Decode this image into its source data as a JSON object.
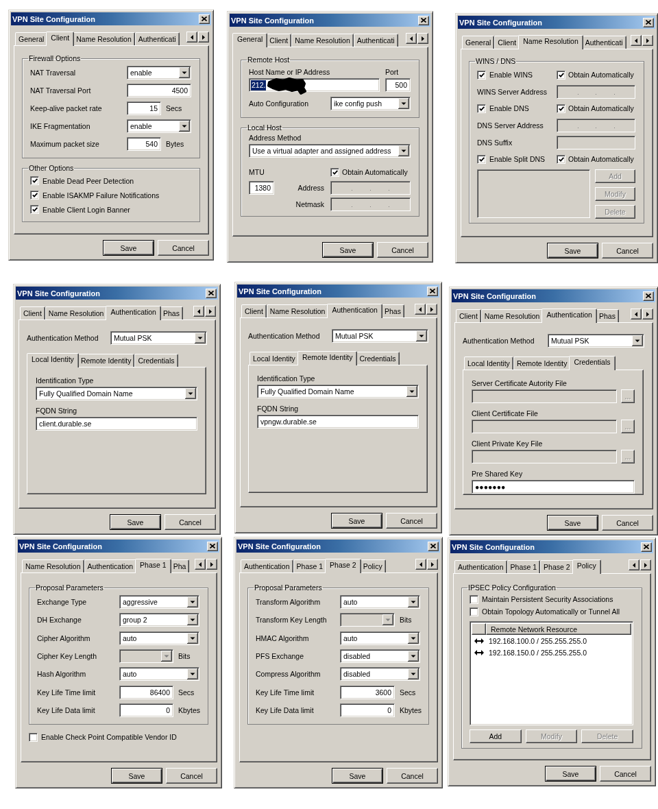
{
  "windows": [
    {
      "title": "VPN Site Configuration",
      "tabs": [
        {
          "label": "General",
          "selected": false
        },
        {
          "label": "Client",
          "selected": true
        },
        {
          "label": "Name Resolution",
          "selected": false
        },
        {
          "label": "Authenticati",
          "selected": false
        }
      ],
      "content": [
        {
          "kind": "group",
          "title": "Firewall Options",
          "items": [
            {
              "kind": "field",
              "label": "NAT Traversal",
              "control": {
                "kind": "select",
                "value": "enable",
                "disabled": false
              }
            },
            {
              "kind": "field",
              "label": "NAT Traversal Port",
              "control": {
                "kind": "text",
                "value": "4500",
                "disabled": false
              }
            },
            {
              "kind": "field",
              "label": "Keep-alive packet rate",
              "unit": "Secs",
              "control": {
                "kind": "text",
                "value": "15",
                "disabled": false
              }
            },
            {
              "kind": "field",
              "label": "IKE Fragmentation",
              "control": {
                "kind": "select",
                "value": "enable",
                "disabled": false
              }
            },
            {
              "kind": "field",
              "label": "Maximum packet size",
              "unit": "Bytes",
              "control": {
                "kind": "text",
                "value": "540",
                "disabled": false
              }
            }
          ]
        },
        {
          "kind": "group",
          "title": "Other Options",
          "items": [
            {
              "kind": "checkbox",
              "label": "Enable Dead Peer Detection",
              "checked": true
            },
            {
              "kind": "checkbox",
              "label": "Enable ISAKMP Failure Notifications",
              "checked": true
            },
            {
              "kind": "checkbox",
              "label": "Enable Client Login Banner",
              "checked": true
            }
          ]
        }
      ],
      "buttons": [
        {
          "label": "Save",
          "default": true
        },
        {
          "label": "Cancel",
          "default": false
        }
      ]
    },
    {
      "title": "VPN Site Configuration",
      "tabs": [
        {
          "label": "General",
          "selected": true
        },
        {
          "label": "Client",
          "selected": false
        },
        {
          "label": "Name Resolution",
          "selected": false
        },
        {
          "label": "Authenticati",
          "selected": false
        }
      ],
      "content": [
        {
          "kind": "group",
          "title": "Remote Host",
          "items": [
            {
              "kind": "host_port",
              "label": "Host Name or IP Address",
              "value": "212.",
              "selected": true,
              "redacted": true,
              "port_label": "Port",
              "port": "500"
            },
            {
              "kind": "field",
              "label": "Auto Configuration",
              "control": {
                "kind": "select",
                "value": "ike config push",
                "disabled": false
              }
            }
          ]
        },
        {
          "kind": "group",
          "title": "Local Host",
          "items": [
            {
              "kind": "stacked",
              "label": "Address Method",
              "control": {
                "kind": "select",
                "value": "Use a virtual adapter and assigned address",
                "disabled": false
              }
            },
            {
              "kind": "mtu",
              "label": "MTU",
              "value": "1380",
              "checkbox": {
                "label": "Obtain Automatically",
                "checked": true
              },
              "fields": [
                {
                  "label": "Address",
                  "control": {
                    "kind": "ip",
                    "disabled": true
                  }
                },
                {
                  "label": "Netmask",
                  "control": {
                    "kind": "ip",
                    "disabled": true
                  }
                }
              ]
            }
          ]
        }
      ],
      "buttons": [
        {
          "label": "Save",
          "default": true
        },
        {
          "label": "Cancel",
          "default": false
        }
      ]
    },
    {
      "title": "VPN Site Configuration",
      "tabs": [
        {
          "label": "General",
          "selected": false
        },
        {
          "label": "Client",
          "selected": false
        },
        {
          "label": "Name Resolution",
          "selected": true
        },
        {
          "label": "Authenticati",
          "selected": false
        }
      ],
      "content": [
        {
          "kind": "group",
          "title": "WINS / DNS",
          "items": [
            {
              "kind": "checkbox_pair",
              "items": [
                {
                  "label": "Enable WINS",
                  "checked": true
                },
                {
                  "label": "Obtain Automatically",
                  "checked": true
                }
              ]
            },
            {
              "kind": "field",
              "label": "WINS Server Address",
              "control": {
                "kind": "ip",
                "disabled": true
              }
            },
            {
              "kind": "checkbox_pair",
              "items": [
                {
                  "label": "Enable DNS",
                  "checked": true
                },
                {
                  "label": "Obtain Automatically",
                  "checked": true
                }
              ]
            },
            {
              "kind": "field",
              "label": "DNS Server Address",
              "control": {
                "kind": "ip",
                "disabled": true
              }
            },
            {
              "kind": "field",
              "label": "DNS Suffix",
              "control": {
                "kind": "text",
                "disabled": true
              }
            },
            {
              "kind": "checkbox_pair",
              "items": [
                {
                  "label": "Enable Split DNS",
                  "checked": true
                },
                {
                  "label": "Obtain Automatically",
                  "checked": true
                }
              ]
            },
            {
              "kind": "list_buttons",
              "disabled": true,
              "buttons": [
                {
                  "label": "Add",
                  "disabled": true
                },
                {
                  "label": "Modify",
                  "disabled": true
                },
                {
                  "label": "Delete",
                  "disabled": true
                }
              ]
            }
          ]
        }
      ],
      "buttons": [
        {
          "label": "Save",
          "default": true
        },
        {
          "label": "Cancel",
          "default": false
        }
      ]
    },
    {
      "title": "VPN Site Configuration",
      "tabs": [
        {
          "label": "Client",
          "selected": false
        },
        {
          "label": "Name Resolution",
          "selected": false
        },
        {
          "label": "Authentication",
          "selected": true
        },
        {
          "label": "Phas",
          "selected": false
        }
      ],
      "content": [
        {
          "kind": "field",
          "label": "Authentication Method",
          "control": {
            "kind": "select",
            "value": "Mutual PSK",
            "disabled": false
          }
        },
        {
          "kind": "subtabs",
          "tabs": [
            {
              "label": "Local Identity",
              "selected": true
            },
            {
              "label": "Remote Identity",
              "selected": false
            },
            {
              "label": "Credentials",
              "selected": false
            }
          ],
          "items": [
            {
              "kind": "stacked",
              "label": "Identification Type",
              "control": {
                "kind": "select",
                "value": "Fully Qualified Domain Name",
                "disabled": false
              }
            },
            {
              "kind": "stacked",
              "label": "FQDN String",
              "control": {
                "kind": "text",
                "value": "client.durable.se",
                "disabled": false
              }
            }
          ]
        }
      ],
      "buttons": [
        {
          "label": "Save",
          "default": true
        },
        {
          "label": "Cancel",
          "default": false
        }
      ]
    },
    {
      "title": "VPN Site Configuration",
      "tabs": [
        {
          "label": "Client",
          "selected": false
        },
        {
          "label": "Name Resolution",
          "selected": false
        },
        {
          "label": "Authentication",
          "selected": true
        },
        {
          "label": "Phas",
          "selected": false
        }
      ],
      "content": [
        {
          "kind": "field",
          "label": "Authentication Method",
          "control": {
            "kind": "select",
            "value": "Mutual PSK",
            "disabled": false
          }
        },
        {
          "kind": "subtabs",
          "tabs": [
            {
              "label": "Local Identity",
              "selected": false
            },
            {
              "label": "Remote Identity",
              "selected": true
            },
            {
              "label": "Credentials",
              "selected": false
            }
          ],
          "items": [
            {
              "kind": "stacked",
              "label": "Identification Type",
              "control": {
                "kind": "select",
                "value": "Fully Qualified Domain Name",
                "disabled": false
              }
            },
            {
              "kind": "stacked",
              "label": "FQDN String",
              "control": {
                "kind": "text",
                "value": "vpngw.durable.se",
                "disabled": false
              }
            }
          ]
        }
      ],
      "buttons": [
        {
          "label": "Save",
          "default": true
        },
        {
          "label": "Cancel",
          "default": false
        }
      ]
    },
    {
      "title": "VPN Site Configuration",
      "tabs": [
        {
          "label": "Client",
          "selected": false
        },
        {
          "label": "Name Resolution",
          "selected": false
        },
        {
          "label": "Authentication",
          "selected": true
        },
        {
          "label": "Phas",
          "selected": false
        }
      ],
      "content": [
        {
          "kind": "field",
          "label": "Authentication Method",
          "control": {
            "kind": "select",
            "value": "Mutual PSK",
            "disabled": false
          }
        },
        {
          "kind": "subtabs",
          "tabs": [
            {
              "label": "Local Identity",
              "selected": false
            },
            {
              "label": "Remote Identity",
              "selected": false
            },
            {
              "label": "Credentials",
              "selected": true
            }
          ],
          "items": [
            {
              "kind": "stacked",
              "label": "Server Certificate Autority File",
              "control": {
                "kind": "text",
                "disabled": true
              },
              "browse": {
                "label": "...",
                "disabled": true
              }
            },
            {
              "kind": "stacked",
              "label": "Client Certificate File",
              "control": {
                "kind": "text",
                "disabled": true
              },
              "browse": {
                "label": "...",
                "disabled": true
              }
            },
            {
              "kind": "stacked",
              "label": "Client Private Key File",
              "control": {
                "kind": "text",
                "disabled": true
              },
              "browse": {
                "label": "...",
                "disabled": true
              }
            },
            {
              "kind": "stacked",
              "label": "Pre Shared Key",
              "control": {
                "kind": "text",
                "value": "●●●●●●●",
                "disabled": false
              }
            }
          ]
        }
      ],
      "buttons": [
        {
          "label": "Save",
          "default": true
        },
        {
          "label": "Cancel",
          "default": false
        }
      ]
    },
    {
      "title": "VPN Site Configuration",
      "tabs": [
        {
          "label": "Name Resolution",
          "selected": false
        },
        {
          "label": "Authentication",
          "selected": false
        },
        {
          "label": "Phase 1",
          "selected": true
        },
        {
          "label": "Pha",
          "selected": false
        }
      ],
      "content": [
        {
          "kind": "group",
          "title": "Proposal Parameters",
          "items": [
            {
              "kind": "field",
              "label": "Exchange Type",
              "control": {
                "kind": "select",
                "value": "aggressive",
                "disabled": false
              }
            },
            {
              "kind": "field",
              "label": "DH Exchange",
              "control": {
                "kind": "select",
                "value": "group 2",
                "disabled": false
              }
            },
            {
              "kind": "field",
              "label": "Cipher Algorithm",
              "control": {
                "kind": "select",
                "value": "auto",
                "disabled": false
              }
            },
            {
              "kind": "field",
              "label": "Cipher Key Length",
              "unit": "Bits",
              "control": {
                "kind": "select",
                "disabled": true
              }
            },
            {
              "kind": "field",
              "label": "Hash Algorithm",
              "control": {
                "kind": "select",
                "value": "auto",
                "disabled": false
              }
            },
            {
              "kind": "field",
              "label": "Key Life Time limit",
              "unit": "Secs",
              "control": {
                "kind": "text",
                "value": "86400",
                "disabled": false
              }
            },
            {
              "kind": "field",
              "label": "Key Life Data limit",
              "unit": "Kbytes",
              "control": {
                "kind": "text",
                "value": "0",
                "disabled": false
              }
            }
          ]
        },
        {
          "kind": "checkbox",
          "label": "Enable Check Point Compatible Vendor ID",
          "checked": false
        }
      ],
      "buttons": [
        {
          "label": "Save",
          "default": true
        },
        {
          "label": "Cancel",
          "default": false
        }
      ]
    },
    {
      "title": "VPN Site Configuration",
      "tabs": [
        {
          "label": "Authentication",
          "selected": false
        },
        {
          "label": "Phase 1",
          "selected": false
        },
        {
          "label": "Phase 2",
          "selected": true
        },
        {
          "label": "Policy",
          "selected": false
        }
      ],
      "content": [
        {
          "kind": "group",
          "title": "Proposal Parameters",
          "items": [
            {
              "kind": "field",
              "label": "Transform Algorithm",
              "control": {
                "kind": "select",
                "value": "auto",
                "disabled": false
              }
            },
            {
              "kind": "field",
              "label": "Transform Key Length",
              "unit": "Bits",
              "control": {
                "kind": "select",
                "disabled": true
              }
            },
            {
              "kind": "field",
              "label": "HMAC Algorithm",
              "control": {
                "kind": "select",
                "value": "auto",
                "disabled": false
              }
            },
            {
              "kind": "field",
              "label": "PFS Exchange",
              "control": {
                "kind": "select",
                "value": "disabled",
                "disabled": false
              }
            },
            {
              "kind": "field",
              "label": "Compress Algorithm",
              "control": {
                "kind": "select",
                "value": "disabled",
                "disabled": false
              }
            },
            {
              "kind": "field",
              "label": "Key Life Time limit",
              "unit": "Secs",
              "control": {
                "kind": "text",
                "value": "3600",
                "disabled": false
              }
            },
            {
              "kind": "field",
              "label": "Key Life Data limit",
              "unit": "Kbytes",
              "control": {
                "kind": "text",
                "value": "0",
                "disabled": false
              }
            }
          ]
        }
      ],
      "buttons": [
        {
          "label": "Save",
          "default": true
        },
        {
          "label": "Cancel",
          "default": false
        }
      ]
    },
    {
      "title": "VPN Site Configuration",
      "tabs": [
        {
          "label": "Authentication",
          "selected": false
        },
        {
          "label": "Phase 1",
          "selected": false
        },
        {
          "label": "Phase 2",
          "selected": false
        },
        {
          "label": "Policy",
          "selected": true
        }
      ],
      "content": [
        {
          "kind": "group",
          "title": "IPSEC Policy Configuration",
          "items": [
            {
              "kind": "checkbox",
              "label": "Maintain Persistent Security Associations",
              "checked": false
            },
            {
              "kind": "checkbox",
              "label": "Obtain Topology Automatically or Tunnel All",
              "checked": false
            },
            {
              "kind": "listview",
              "columns": [
                "Remote Network Resource"
              ],
              "rows": [
                "192.168.100.0 / 255.255.255.0",
                "192.168.150.0 / 255.255.255.0"
              ]
            },
            {
              "kind": "buttons",
              "buttons": [
                {
                  "label": "Add",
                  "disabled": false
                },
                {
                  "label": "Modify",
                  "disabled": true
                },
                {
                  "label": "Delete",
                  "disabled": true
                }
              ]
            }
          ]
        }
      ],
      "buttons": [
        {
          "label": "Save",
          "default": true
        },
        {
          "label": "Cancel",
          "default": false
        }
      ]
    }
  ]
}
